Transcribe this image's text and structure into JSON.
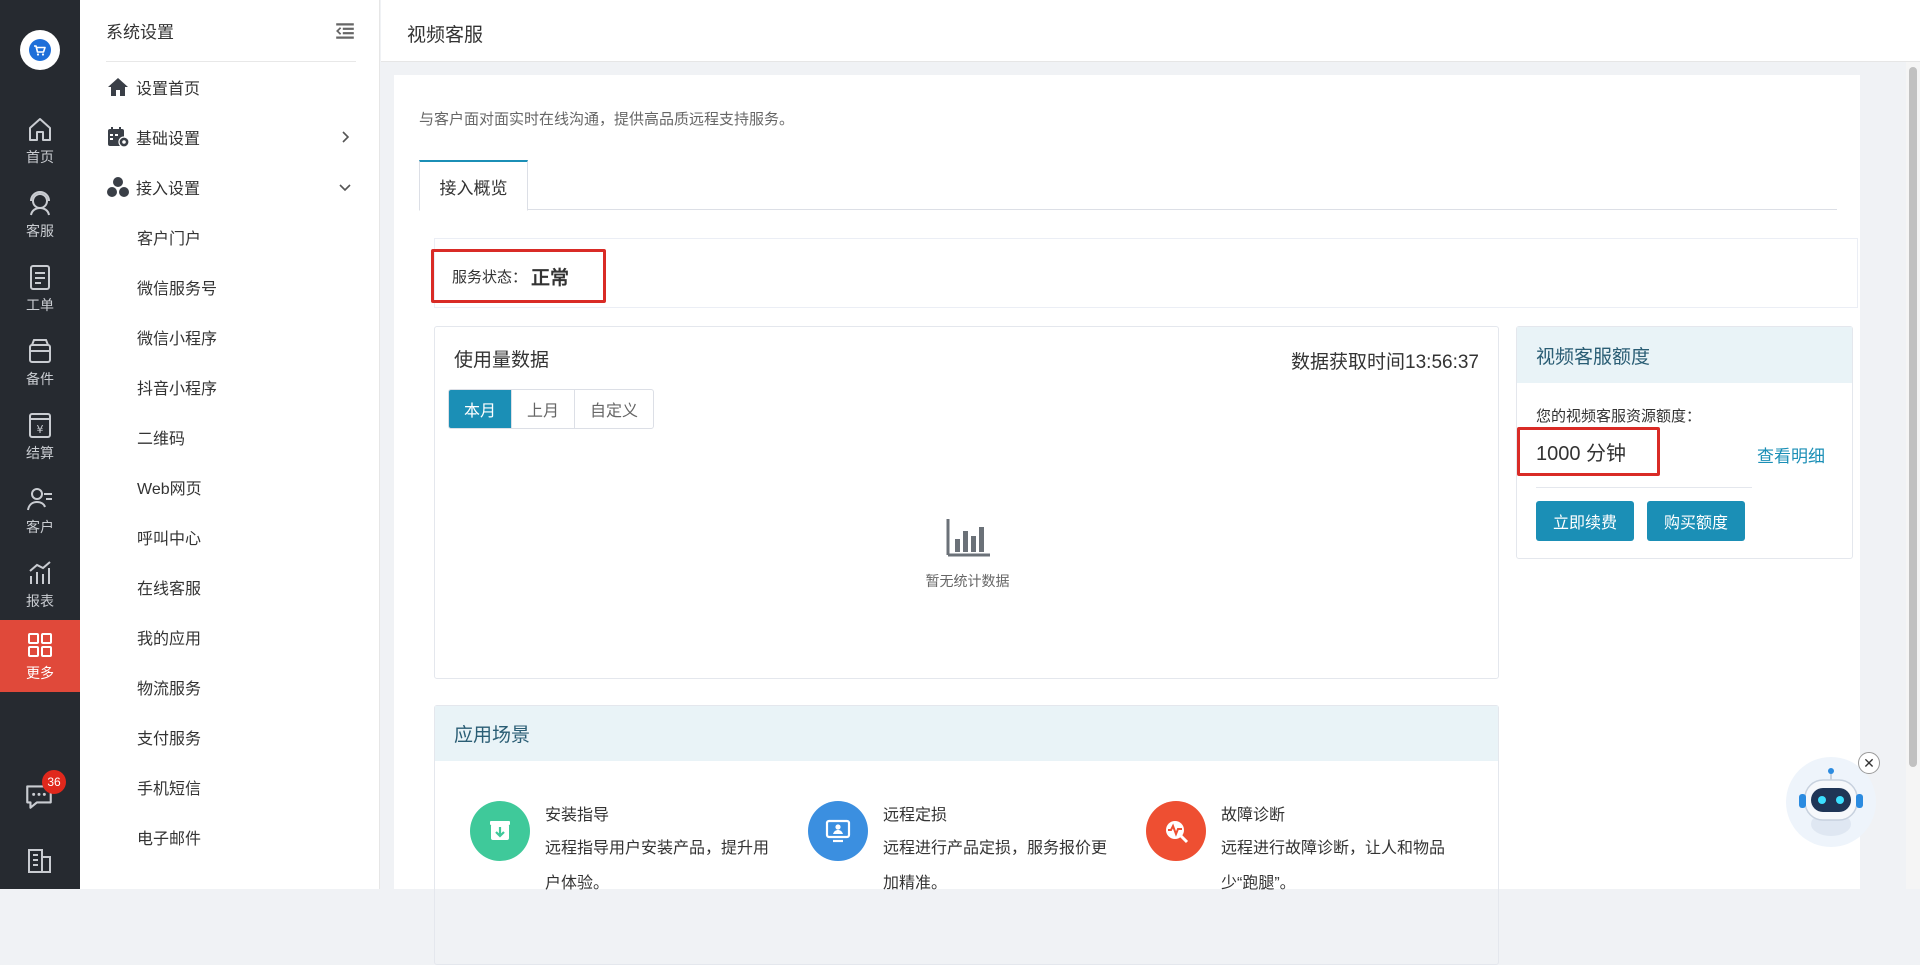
{
  "rail": {
    "items": [
      {
        "label": "首页",
        "icon": "home-icon"
      },
      {
        "label": "客服",
        "icon": "headset-icon"
      },
      {
        "label": "工单",
        "icon": "ticket-icon"
      },
      {
        "label": "备件",
        "icon": "box-icon"
      },
      {
        "label": "结算",
        "icon": "settlement-icon"
      },
      {
        "label": "客户",
        "icon": "customer-icon"
      },
      {
        "label": "报表",
        "icon": "report-icon"
      },
      {
        "label": "更多",
        "icon": "grid-icon",
        "active": true
      }
    ],
    "chat_badge": "36"
  },
  "sidebar": {
    "title": "系统设置",
    "top_items": [
      {
        "label": "设置首页"
      },
      {
        "label": "基础设置"
      },
      {
        "label": "接入设置"
      }
    ],
    "sub_items": [
      {
        "label": "客户门户"
      },
      {
        "label": "微信服务号"
      },
      {
        "label": "微信小程序"
      },
      {
        "label": "抖音小程序"
      },
      {
        "label": "二维码"
      },
      {
        "label": "Web网页"
      },
      {
        "label": "呼叫中心"
      },
      {
        "label": "在线客服"
      },
      {
        "label": "我的应用"
      },
      {
        "label": "物流服务"
      },
      {
        "label": "支付服务"
      },
      {
        "label": "手机短信"
      },
      {
        "label": "电子邮件"
      }
    ]
  },
  "header": {
    "title": "视频客服"
  },
  "main": {
    "description": "与客户面对面实时在线沟通，提供高品质远程支持服务。",
    "tab": "接入概览",
    "status_label": "服务状态：",
    "status_value": "正常",
    "usage": {
      "title": "使用量数据",
      "fetch_time": "数据获取时间13:56:37",
      "segments": [
        "本月",
        "上月",
        "自定义"
      ],
      "empty_text": "暂无统计数据"
    },
    "quota": {
      "title": "视频客服额度",
      "label": "您的视频客服资源额度：",
      "value": "1000 分钟",
      "detail_link": "查看明细",
      "renew_button": "立即续费",
      "buy_button": "购买额度"
    },
    "scenes": {
      "title": "应用场景",
      "items": [
        {
          "title": "安装指导",
          "desc": "远程指导用户安装产品，提升用户体验。",
          "color": "#3fc99a"
        },
        {
          "title": "远程定损",
          "desc": "远程进行产品定损，服务报价更加精准。",
          "color": "#3b8fe0"
        },
        {
          "title": "故障诊断",
          "desc": "远程进行故障诊断，让人和物品少“跑腿”。",
          "color": "#ee4f32"
        }
      ]
    }
  },
  "colors": {
    "accent": "#1b8fb6",
    "rail_bg": "#262a30",
    "rail_active": "#e0493a",
    "highlight_box": "#d92b26"
  }
}
